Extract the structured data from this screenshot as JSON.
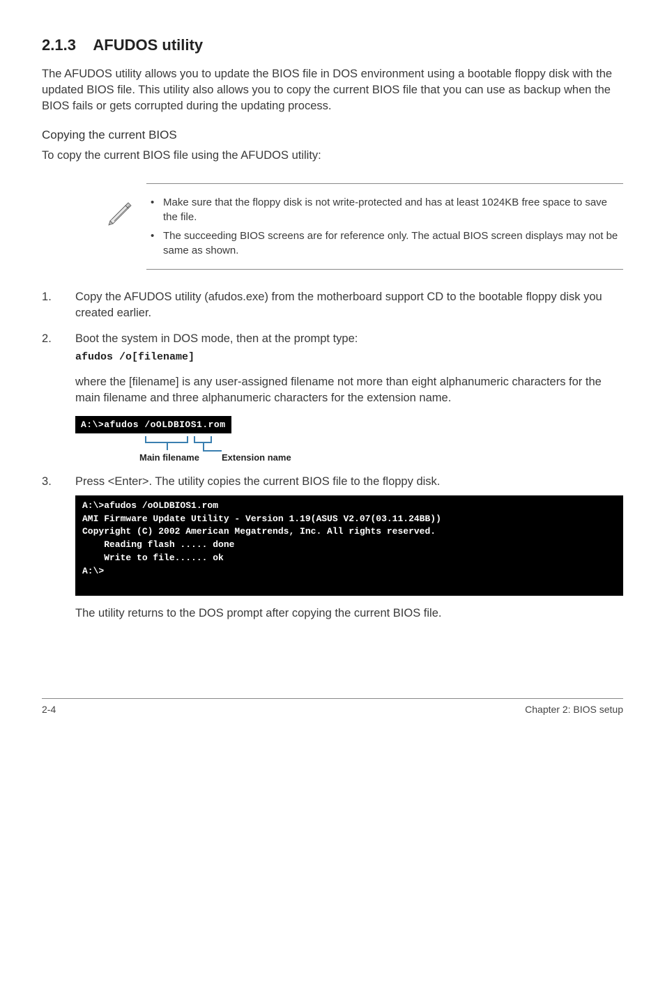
{
  "section": {
    "number": "2.1.3",
    "title": "AFUDOS utility"
  },
  "intro": "The AFUDOS utility allows you to update the BIOS file in DOS environment using a bootable floppy disk with the updated BIOS file. This utility also allows you to copy the current BIOS file that you can use as backup when the BIOS fails or gets corrupted during the updating process.",
  "subheading": "Copying the current BIOS",
  "subintro": "To copy the current BIOS file using the AFUDOS utility:",
  "notes": [
    "Make sure that the floppy disk is not write-protected and has at least 1024KB free space to save the file.",
    "The succeeding BIOS screens are for reference only. The actual BIOS screen displays may not be same as shown."
  ],
  "steps": {
    "s1": "Copy the AFUDOS utility (afudos.exe) from the motherboard support CD to the bootable floppy disk you created earlier.",
    "s2": "Boot the system in DOS mode, then at the prompt type:",
    "s2_cmd": "afudos /o[filename]",
    "s2_after": "where the [filename] is any user-assigned filename not more than eight alphanumeric characters  for the main filename and three alphanumeric characters for the extension name.",
    "s3": "Press <Enter>. The utility copies the current BIOS file to the floppy disk."
  },
  "terminal1": "A:\\>afudos /oOLDBIOS1.rom",
  "labels": {
    "main": "Main filename",
    "ext": "Extension name"
  },
  "terminal2": "A:\\>afudos /oOLDBIOS1.rom\nAMI Firmware Update Utility - Version 1.19(ASUS V2.07(03.11.24BB))\nCopyright (C) 2002 American Megatrends, Inc. All rights reserved.\n    Reading flash ..... done\n    Write to file...... ok\nA:\\>\n\n",
  "closing": "The utility returns to the DOS prompt after copying the current BIOS file.",
  "footer": {
    "left": "2-4",
    "right": "Chapter 2: BIOS setup"
  }
}
